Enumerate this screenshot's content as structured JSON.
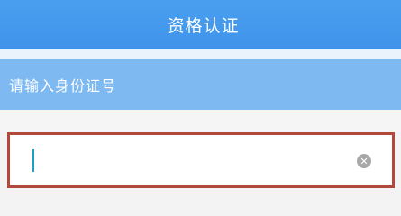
{
  "header": {
    "title": "资格认证"
  },
  "form": {
    "prompt": "请输入身份证号",
    "id_number": {
      "value": "",
      "clear_icon": "clear-icon"
    }
  },
  "colors": {
    "header_bg": "#4a9ff0",
    "prompt_bg": "#7fb9f2",
    "input_border": "#b2473b",
    "caret": "#1aa1c9"
  }
}
